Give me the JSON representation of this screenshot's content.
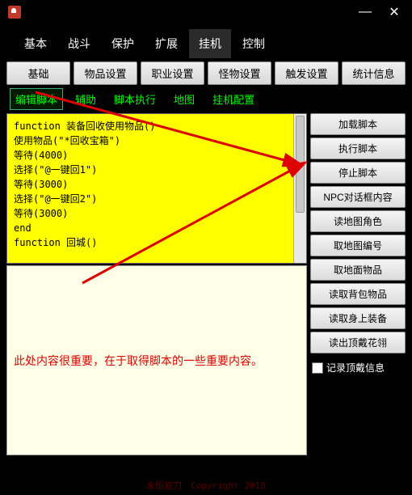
{
  "titlebar": {
    "minimize": "—",
    "close": "✕"
  },
  "tabs_top": [
    "基本",
    "战斗",
    "保护",
    "扩展",
    "挂机",
    "控制"
  ],
  "tabs_top_active": 4,
  "row1": [
    "基础",
    "物品设置",
    "职业设置",
    "怪物设置",
    "触发设置",
    "统计信息"
  ],
  "row2": [
    "编辑脚本",
    "辅助",
    "脚本执行",
    "地图",
    "挂机配置"
  ],
  "row2_active": 0,
  "script_lines": [
    "function 装备回收使用物品()",
    "使用物品(\"*回收宝箱\")",
    "等待(4000)",
    "选择(\"@一键回1\")",
    "等待(3000)",
    "选择(\"@一键回2\")",
    "等待(3000)",
    "end",
    "",
    "",
    "function 回城()"
  ],
  "side_buttons": [
    "加载脚本",
    "执行脚本",
    "停止脚本",
    "NPC对话框内容",
    "读地图角色",
    "取地图编号",
    "取地面物品",
    "读取背包物品",
    "读取身上装备",
    "读出顶戴花翎"
  ],
  "checkbox_label": "记录顶戴信息",
  "info_text": "此处内容很重要，在于取得脚本的一些重要内容。",
  "footer": "永恒狂刀　Copyright 2018"
}
